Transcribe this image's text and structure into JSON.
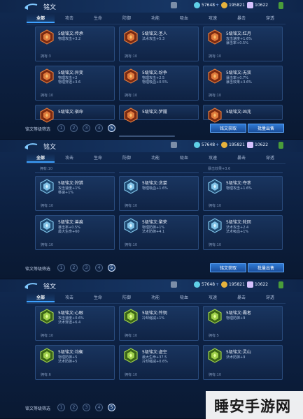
{
  "screens": [
    {
      "title": "铭文",
      "resources": {
        "coupon": "57648",
        "gold": "195821",
        "gems": "10622"
      },
      "tabs": [
        "全部",
        "攻击",
        "生命",
        "防御",
        "功能",
        "吸血",
        "攻速",
        "暴击",
        "穿透"
      ],
      "active_tab": 0,
      "top_partial": false,
      "cards": [
        {
          "name": "5级铭文:传承",
          "attrs": [
            "物理攻击+3.2"
          ],
          "owned": "拥有:3",
          "color": "red"
        },
        {
          "name": "5级铭文:圣人",
          "attrs": [
            "法术攻击+5.3"
          ],
          "owned": "拥有:10",
          "color": "red"
        },
        {
          "name": "5级铭文:红月",
          "attrs": [
            "攻击速度+1.6%",
            "暴击率+0.5%"
          ],
          "owned": "拥有:10",
          "color": "red"
        },
        {
          "name": "5级铭文:异变",
          "attrs": [
            "物理攻击+2",
            "物理穿透+3.6"
          ],
          "owned": "拥有:10",
          "color": "red"
        },
        {
          "name": "5级铭文:纷争",
          "attrs": [
            "物理攻击+2.5",
            "物理吸血+0.5%"
          ],
          "owned": "拥有:10",
          "color": "red"
        },
        {
          "name": "5级铭文:无双",
          "attrs": [
            "暴击率+0.7%",
            "暴击效果+3.6%"
          ],
          "owned": "拥有:10",
          "color": "red"
        },
        {
          "name": "5级铭文:宿命",
          "attrs": [],
          "owned": "",
          "color": "red"
        },
        {
          "name": "5级铭文:梦魇",
          "attrs": [],
          "owned": "",
          "color": "red"
        },
        {
          "name": "5级铭文:凶兆",
          "attrs": [],
          "owned": "",
          "color": "red"
        }
      ],
      "filter_label": "铭文等级筛选",
      "levels": [
        "1",
        "2",
        "3",
        "4",
        "5"
      ],
      "active_level": 4,
      "btn_get": "铭文获取",
      "btn_sell": "批量出售"
    },
    {
      "title": "铭文",
      "resources": {
        "coupon": "57648",
        "gold": "195821",
        "gems": "10622"
      },
      "tabs": [
        "全部",
        "攻击",
        "生命",
        "防御",
        "功能",
        "吸血",
        "攻速",
        "暴击",
        "穿透"
      ],
      "active_tab": 0,
      "top_partial": true,
      "top_partial_text": [
        "拥有:10",
        "",
        "暴击效果+3.6"
      ],
      "cards": [
        {
          "name": "5级铭文:狩猎",
          "attrs": [
            "攻击速度+1%",
            "移速+1%"
          ],
          "owned": "拥有:10",
          "color": "blue"
        },
        {
          "name": "5级铭文:贪婪",
          "attrs": [
            "物理吸血+1.6%"
          ],
          "owned": "拥有:10",
          "color": "blue"
        },
        {
          "name": "5级铭文:夺萃",
          "attrs": [
            "物理攻击+1.6%"
          ],
          "owned": "拥有:10",
          "color": "blue"
        },
        {
          "name": "5级铭文:兽痕",
          "attrs": [
            "暴击率+0.5%",
            "最大生命+60"
          ],
          "owned": "拥有:10",
          "color": "blue"
        },
        {
          "name": "5级铭文:繁荣",
          "attrs": [
            "物理防御+1%",
            "法术防御+4.1"
          ],
          "owned": "拥有:10",
          "color": "blue"
        },
        {
          "name": "5级铭文:轮回",
          "attrs": [
            "法术攻击+2.4",
            "法术吸血+1%"
          ],
          "owned": "拥有:10",
          "color": "blue"
        }
      ],
      "filter_label": "铭文等级筛选",
      "levels": [
        "1",
        "2",
        "3",
        "4",
        "5"
      ],
      "active_level": 4,
      "btn_get": "铭文获取",
      "btn_sell": "批量出售"
    },
    {
      "title": "铭文",
      "resources": {
        "coupon": "57648",
        "gold": "195821",
        "gems": "10622"
      },
      "tabs": [
        "全部",
        "攻击",
        "生命",
        "防御",
        "功能",
        "吸血",
        "攻速",
        "暴击",
        "穿透"
      ],
      "active_tab": 0,
      "top_partial": false,
      "cards": [
        {
          "name": "5级铭文:心眼",
          "attrs": [
            "攻击速度+0.6%",
            "法术穿透+6.4"
          ],
          "owned": "拥有:10",
          "color": "green"
        },
        {
          "name": "5级铭文:怜悯",
          "attrs": [
            "冷却缩减+1%"
          ],
          "owned": "拥有:10",
          "color": "green"
        },
        {
          "name": "5级铭文:霸者",
          "attrs": [
            "物理防御+9"
          ],
          "owned": "拥有:5",
          "color": "green"
        },
        {
          "name": "5级铭文:均衡",
          "attrs": [
            "物理防御+5",
            "法术防御+5"
          ],
          "owned": "拥有:6",
          "color": "green"
        },
        {
          "name": "5级铭文:虚空",
          "attrs": [
            "最大生命+37.5",
            "冷却缩减+0.6%"
          ],
          "owned": "拥有:10",
          "color": "green"
        },
        {
          "name": "5级铭文:灵山",
          "attrs": [
            "法术防御+9"
          ],
          "owned": "拥有:10",
          "color": "green"
        }
      ],
      "filter_label": "铭文等级筛选",
      "levels": [
        "1",
        "2",
        "3",
        "4",
        "5"
      ],
      "active_level": 4,
      "btn_get": "",
      "btn_sell": ""
    }
  ],
  "watermark": "睡安手游网",
  "colors": {
    "accent": "#3ea1ff",
    "red": "#c2552a",
    "blue": "#5f9ec9",
    "green": "#86c23a"
  }
}
